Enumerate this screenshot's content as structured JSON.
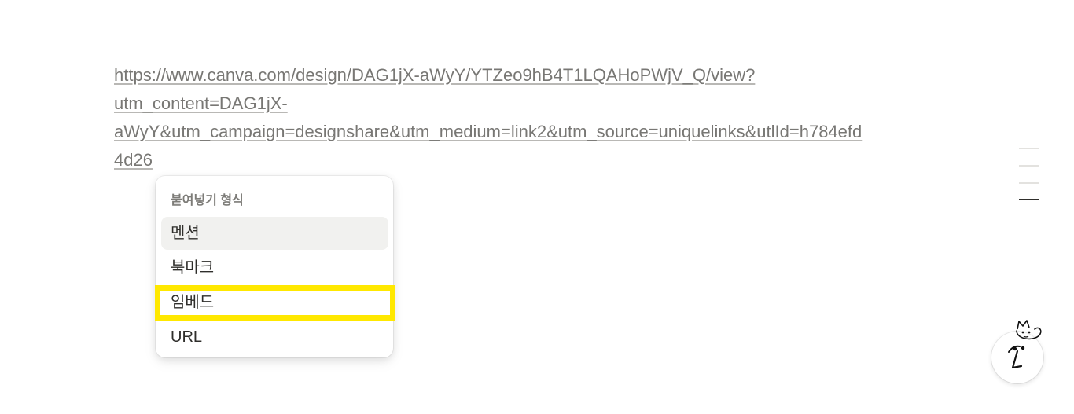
{
  "link": {
    "lines": [
      "https://www.canva.com/design/DAG1jX-aWyY/YTZeo9hB4T1LQAHoPWjV_Q/view?",
      "utm_content=DAG1jX-",
      "aWyY&utm_campaign=designshare&utm_medium=link2&utm_source=uniquelinks&utlId=h784efd",
      "4d26"
    ]
  },
  "paste_menu": {
    "heading": "붙여넣기 형식",
    "items": [
      {
        "label": "멘션",
        "selected": true
      },
      {
        "label": "북마크",
        "selected": false
      },
      {
        "label": "임베드",
        "selected": false,
        "highlighted": true
      },
      {
        "label": "URL",
        "selected": false
      }
    ]
  },
  "colors": {
    "highlight": "#ffe800",
    "link_text": "#787774",
    "selected_item_bg": "#f1f1ef"
  },
  "toc": {
    "entries": 4,
    "active_index": 3
  },
  "icons": {
    "assistant": "notion-ai-face-icon"
  }
}
